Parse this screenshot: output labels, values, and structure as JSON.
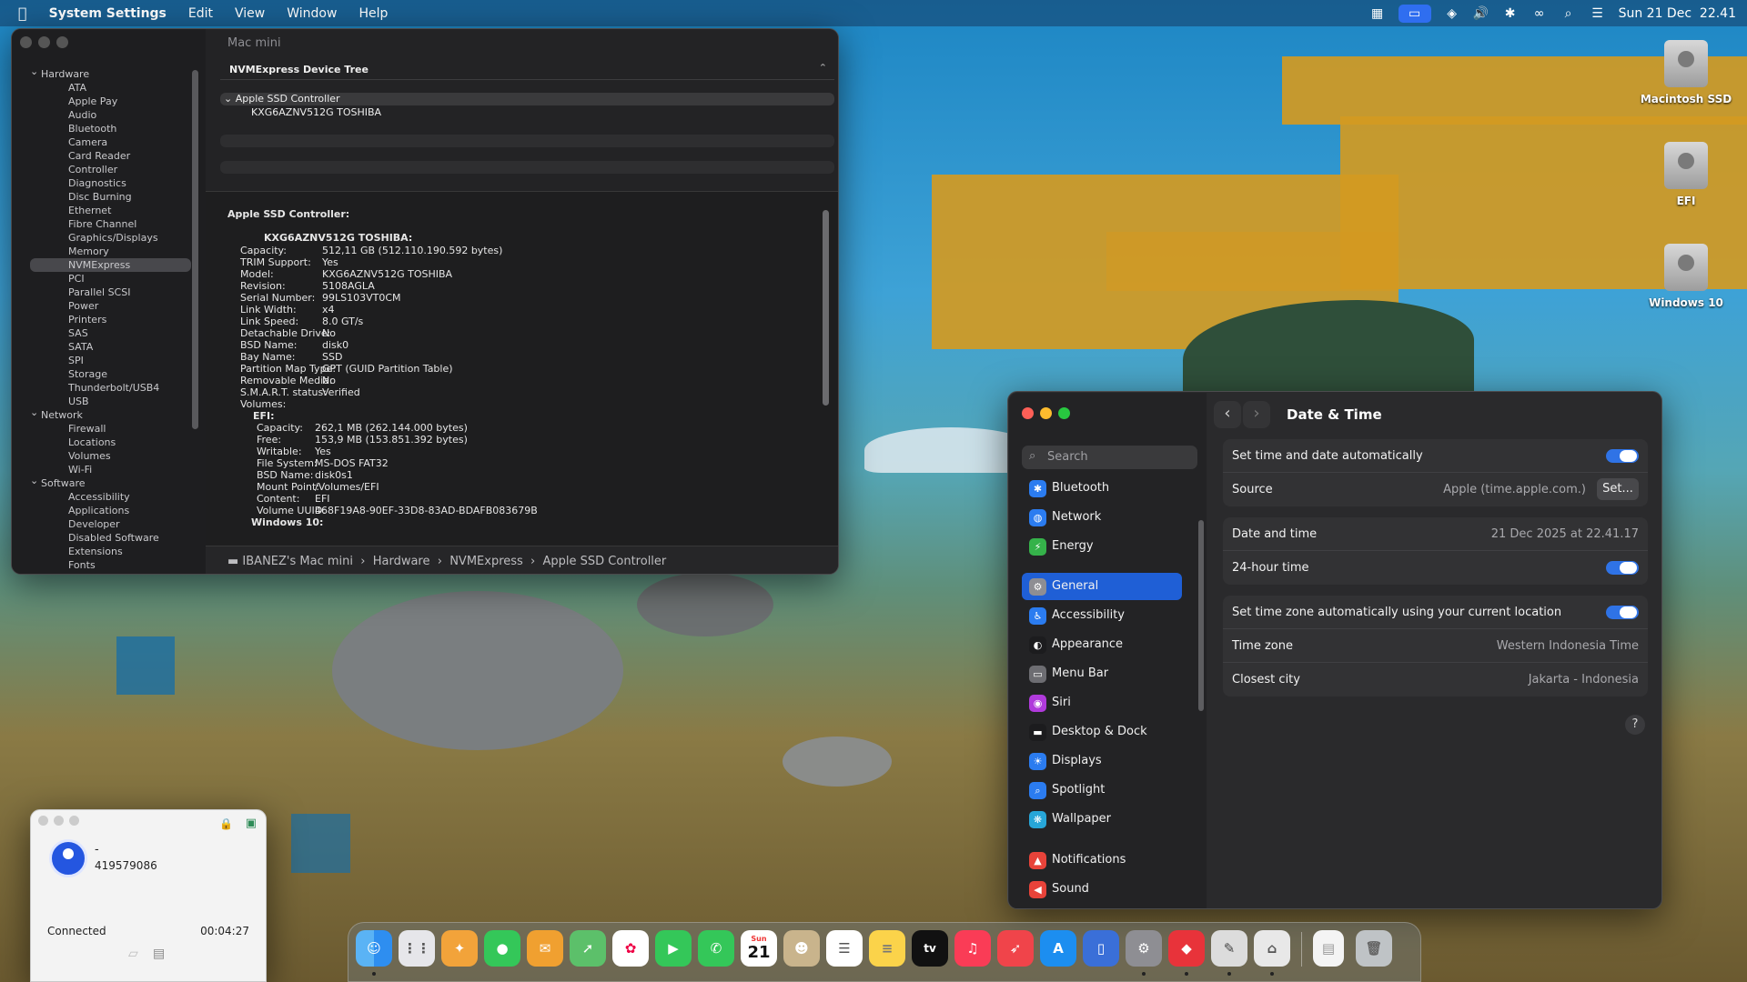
{
  "menubar": {
    "app_name": "System Settings",
    "menus": [
      "Edit",
      "View",
      "Window",
      "Help"
    ],
    "clock": "Sun 21 Dec  22.41"
  },
  "desktop": {
    "icons": [
      "Macintosh SSD",
      "EFI",
      "Windows 10"
    ]
  },
  "system_info": {
    "window_title": "Mac mini",
    "sidebar": {
      "hardware_label": "Hardware",
      "hardware_items": [
        "ATA",
        "Apple Pay",
        "Audio",
        "Bluetooth",
        "Camera",
        "Card Reader",
        "Controller",
        "Diagnostics",
        "Disc Burning",
        "Ethernet",
        "Fibre Channel",
        "Graphics/Displays",
        "Memory",
        "NVMExpress",
        "PCI",
        "Parallel SCSI",
        "Power",
        "Printers",
        "SAS",
        "SATA",
        "SPI",
        "Storage",
        "Thunderbolt/USB4",
        "USB"
      ],
      "selected": "NVMExpress",
      "network_label": "Network",
      "network_items": [
        "Firewall",
        "Locations",
        "Volumes",
        "Wi-Fi"
      ],
      "software_label": "Software",
      "software_items": [
        "Accessibility",
        "Applications",
        "Developer",
        "Disabled Software",
        "Extensions",
        "Fonts"
      ]
    },
    "tree": {
      "header": "NVMExpress Device Tree",
      "controller": "Apple SSD Controller",
      "device": "KXG6AZNV512G TOSHIBA"
    },
    "detail": {
      "heading": "Apple SSD Controller:",
      "device": "KXG6AZNV512G TOSHIBA:",
      "fields": [
        [
          "Capacity:",
          "512,11 GB (512.110.190.592 bytes)"
        ],
        [
          "TRIM Support:",
          "Yes"
        ],
        [
          "Model:",
          "KXG6AZNV512G TOSHIBA"
        ],
        [
          "Revision:",
          "5108AGLA"
        ],
        [
          "Serial Number:",
          "99LS103VT0CM"
        ],
        [
          "Link Width:",
          "x4"
        ],
        [
          "Link Speed:",
          "8.0 GT/s"
        ],
        [
          "Detachable Drive:",
          "No"
        ],
        [
          "BSD Name:",
          "disk0"
        ],
        [
          "Bay Name:",
          "SSD"
        ],
        [
          "Partition Map Type:",
          "GPT (GUID Partition Table)"
        ],
        [
          "Removable Media:",
          "No"
        ],
        [
          "S.M.A.R.T. status:",
          "Verified"
        ]
      ],
      "volumes_label": "Volumes:",
      "efi_label": "EFI:",
      "efi_fields": [
        [
          "Capacity:",
          "262,1 MB (262.144.000 bytes)"
        ],
        [
          "Free:",
          "153,9 MB (153.851.392 bytes)"
        ],
        [
          "Writable:",
          "Yes"
        ],
        [
          "File System:",
          "MS-DOS FAT32"
        ],
        [
          "BSD Name:",
          "disk0s1"
        ],
        [
          "Mount Point:",
          "/Volumes/EFI"
        ],
        [
          "Content:",
          "EFI"
        ],
        [
          "Volume UUID:",
          "468F19A8-90EF-33D8-83AD-BDAFB083679B"
        ]
      ],
      "win_label": "Windows 10:"
    },
    "pathbar": "IBANEZ's Mac mini  ›  Hardware  ›  NVMExpress  ›  Apple SSD Controller"
  },
  "settings": {
    "search_placeholder": "Search",
    "sidebar": [
      {
        "label": "Bluetooth",
        "icon": "bluetooth-icon",
        "color": "#2b7cf0"
      },
      {
        "label": "Network",
        "icon": "globe-icon",
        "color": "#2b7cf0"
      },
      {
        "label": "Energy",
        "icon": "bolt-icon",
        "color": "#35b24a"
      },
      {
        "label": "General",
        "icon": "gear-icon",
        "color": "#8e8e93"
      },
      {
        "label": "Accessibility",
        "icon": "accessibility-icon",
        "color": "#2b7cf0"
      },
      {
        "label": "Appearance",
        "icon": "appearance-icon",
        "color": "#1c1c1e"
      },
      {
        "label": "Menu Bar",
        "icon": "menubar-icon",
        "color": "#6d6d72"
      },
      {
        "label": "Siri",
        "icon": "siri-icon",
        "color": "#b03adb"
      },
      {
        "label": "Desktop & Dock",
        "icon": "dock-icon",
        "color": "#1c1c1e"
      },
      {
        "label": "Displays",
        "icon": "sun-icon",
        "color": "#2b7cf0"
      },
      {
        "label": "Spotlight",
        "icon": "search-icon",
        "color": "#2b7cf0"
      },
      {
        "label": "Wallpaper",
        "icon": "wallpaper-icon",
        "color": "#27a6d8"
      },
      {
        "label": "Notifications",
        "icon": "bell-icon",
        "color": "#e8433a"
      },
      {
        "label": "Sound",
        "icon": "speaker-icon",
        "color": "#e8433a"
      }
    ],
    "selected": "General",
    "title": "Date & Time",
    "rows": {
      "auto_time": "Set time and date automatically",
      "source_label": "Source",
      "source_value": "Apple (time.apple.com.)",
      "set_button": "Set...",
      "date_label": "Date and time",
      "date_value": "21 Dec 2025 at 22.41.17",
      "hour24": "24-hour time",
      "auto_tz": "Set time zone automatically using your current location",
      "tz_label": "Time zone",
      "tz_value": "Western Indonesia Time",
      "city_label": "Closest city",
      "city_value": "Jakarta - Indonesia"
    },
    "help": "?"
  },
  "call": {
    "name": "-",
    "id": "419579086",
    "status": "Connected",
    "duration": "00:04:27"
  },
  "dock": {
    "calendar_month": "Sun",
    "calendar_day": "21"
  }
}
